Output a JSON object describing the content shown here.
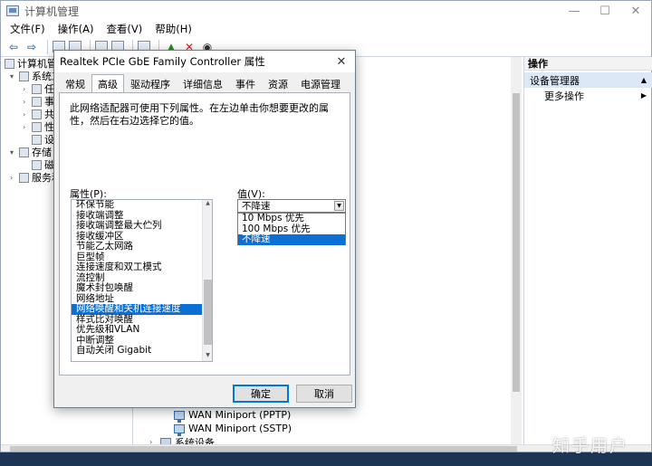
{
  "window": {
    "title": "计算机管理",
    "controls": [
      "—",
      "☐",
      "✕"
    ]
  },
  "menu": [
    "文件(F)",
    "操作(A)",
    "查看(V)",
    "帮助(H)"
  ],
  "tree": [
    {
      "label": "计算机管理",
      "exp": "",
      "indent": 0
    },
    {
      "label": "系统工",
      "exp": "▾",
      "indent": 1
    },
    {
      "label": "任",
      "exp": "›",
      "indent": 2
    },
    {
      "label": "事",
      "exp": "›",
      "indent": 2
    },
    {
      "label": "共",
      "exp": "›",
      "indent": 2
    },
    {
      "label": "性",
      "exp": "›",
      "indent": 2
    },
    {
      "label": "设",
      "exp": "",
      "indent": 2
    },
    {
      "label": "存储",
      "exp": "▾",
      "indent": 1
    },
    {
      "label": "磁",
      "exp": "",
      "indent": 2
    },
    {
      "label": "服务和",
      "exp": "›",
      "indent": 1
    }
  ],
  "middle": {
    "rows": [
      {
        "label": "WAN Miniport (PPTP)",
        "type": "net"
      },
      {
        "label": "WAN Miniport (SSTP)",
        "type": "net"
      },
      {
        "label": "系统设备",
        "type": "folder"
      }
    ]
  },
  "actions": {
    "header": "操作",
    "section": "设备管理器",
    "items": [
      "更多操作"
    ]
  },
  "dialog": {
    "title": "Realtek PCIe GbE Family Controller 属性",
    "close": "✕",
    "tabs": [
      "常规",
      "高级",
      "驱动程序",
      "详细信息",
      "事件",
      "资源",
      "电源管理"
    ],
    "active_tab": "高级",
    "description": "此网络适配器可使用下列属性。在左边单击你想要更改的属性，然后在右边选择它的值。",
    "property_label": "属性(P):",
    "value_label": "值(V):",
    "properties": [
      "环保节能",
      "接收端调整",
      "接收端调整最大伫列",
      "接收缓冲区",
      "节能乙太网路",
      "巨型帧",
      "连接速度和双工模式",
      "流控制",
      "魔术封包唤醒",
      "网络地址",
      "网络唤醒和关机连接速度",
      "样式比对唤醒",
      "优先级和VLAN",
      "中断调整",
      "自动关闭 Gigabit"
    ],
    "selected_property": "网络唤醒和关机连接速度",
    "value_current": "不降速",
    "value_options": [
      "10 Mbps 优先",
      "100 Mbps 优先",
      "不降速"
    ],
    "ok_label": "确定",
    "cancel_label": "取消"
  },
  "watermark": "知乎用户"
}
